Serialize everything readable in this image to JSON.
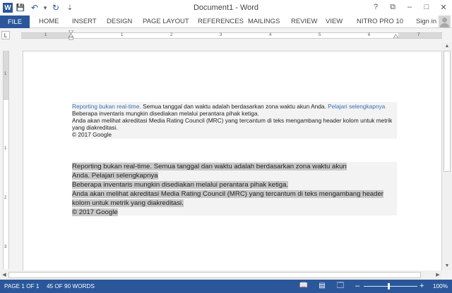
{
  "window": {
    "title": "Document1 - Word",
    "help": "?",
    "restore_ribbon": "⧉",
    "minimize": "–",
    "maximize": "□",
    "close": "✕"
  },
  "qat": {
    "save": "💾",
    "undo": "↶",
    "undo_dd": "▾",
    "redo": "↻",
    "customize": "⇣"
  },
  "ribbon": {
    "file": "FILE",
    "tabs": [
      "HOME",
      "INSERT",
      "DESIGN",
      "PAGE LAYOUT",
      "REFERENCES",
      "MAILINGS",
      "REVIEW",
      "VIEW",
      "NITRO PRO 10"
    ],
    "signin": "Sign in"
  },
  "ruler": {
    "tab_selector": "L",
    "ticks": [
      "1",
      "1",
      "2",
      "3",
      "4",
      "5",
      "6",
      "7"
    ],
    "vticks": [
      "1",
      "1",
      "2",
      "3"
    ]
  },
  "document": {
    "block1": {
      "link1": "Reporting bukan real-time.",
      "text1": " Semua tanggal dan waktu adalah berdasarkan zona waktu akun Anda. ",
      "link2": "Pelajari selengkapnya",
      "line2": "Beberapa inventaris mungkin disediakan melalui perantara pihak ketiga.",
      "line3": "Anda akan melihat akreditasi Media Rating Council (MRC) yang tercantum di teks mengambang header kolom untuk metrik yang diakreditasi.",
      "line4": "© 2017 Google"
    },
    "block2": {
      "lines": [
        "Reporting bukan real-time. Semua tanggal dan waktu adalah berdasarkan zona waktu akun",
        "Anda. Pelajari selengkapnya ",
        "Beberapa inventaris mungkin disediakan melalui perantara pihak ketiga. ",
        "Anda akan melihat akreditasi Media Rating Council (MRC) yang tercantum di teks mengambang header",
        "kolom untuk metrik yang diakreditasi. ",
        "© 2017 Google "
      ]
    }
  },
  "scroll": {
    "up": "▲",
    "down": "▼",
    "left": "◀",
    "right": "▶"
  },
  "status": {
    "page": "PAGE 1 OF 1",
    "words": "45 OF 90 WORDS",
    "read_mode": "📖",
    "print_layout": "▤",
    "web_layout": "🗔",
    "zoom_out": "–",
    "zoom_in": "+",
    "zoom": "100%"
  },
  "colors": {
    "accent": "#2b579a",
    "link": "#3c6fb3",
    "highlight": "#c8c8c8"
  }
}
